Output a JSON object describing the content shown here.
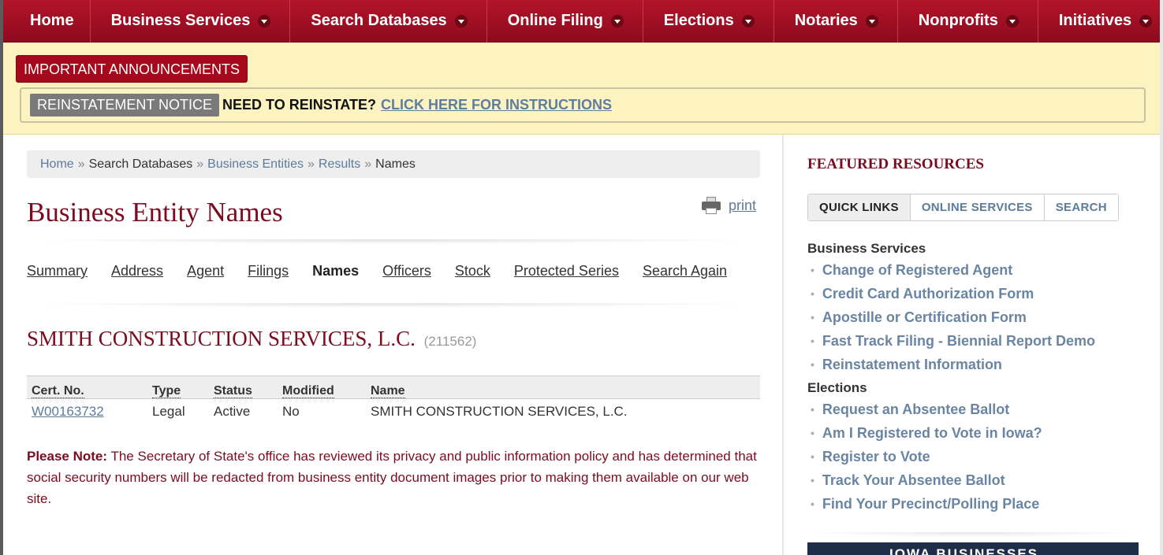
{
  "nav": {
    "items": [
      {
        "label": "Home",
        "dropdown": false
      },
      {
        "label": "Business Services",
        "dropdown": true
      },
      {
        "label": "Search Databases",
        "dropdown": true
      },
      {
        "label": "Online Filing",
        "dropdown": true
      },
      {
        "label": "Elections",
        "dropdown": true
      },
      {
        "label": "Notaries",
        "dropdown": true
      },
      {
        "label": "Nonprofits",
        "dropdown": true
      },
      {
        "label": "Initiatives",
        "dropdown": true
      }
    ]
  },
  "announcements": {
    "button_label": "IMPORTANT ANNOUNCEMENTS",
    "tag": "REINSTATEMENT NOTICE",
    "text": "NEED TO REINSTATE?",
    "link": "CLICK HERE FOR INSTRUCTIONS"
  },
  "breadcrumb": {
    "home": "Home",
    "search_databases": "Search Databases",
    "business_entities": "Business Entities",
    "results": "Results",
    "current": "Names",
    "separator": "»"
  },
  "page": {
    "title": "Business Entity Names",
    "print_label": "print"
  },
  "tabs": [
    "Summary",
    "Address",
    "Agent",
    "Filings",
    "Names",
    "Officers",
    "Stock",
    "Protected Series",
    "Search Again"
  ],
  "entity": {
    "name": "SMITH CONSTRUCTION SERVICES, L.C.",
    "id": "(211562)"
  },
  "table": {
    "headers": [
      "Cert. No.",
      "Type",
      "Status",
      "Modified",
      "Name"
    ],
    "rows": [
      [
        "W00163732",
        "Legal",
        "Active",
        "No",
        "SMITH CONSTRUCTION SERVICES, L.C."
      ]
    ]
  },
  "note": {
    "label": "Please Note:",
    "text": " The Secretary of State's office has reviewed its privacy and public information policy and has determined that social security numbers will be redacted from business entity document images prior to making them available on our web site."
  },
  "sidebar": {
    "title": "FEATURED RESOURCES",
    "tabs": [
      "QUICK LINKS",
      "ONLINE SERVICES",
      "SEARCH"
    ],
    "groups": [
      {
        "heading": "Business Services",
        "links": [
          "Change of Registered Agent",
          "Credit Card Authorization Form",
          "Apostille or Certification Form",
          "Fast Track Filing - Biennial Report Demo",
          "Reinstatement Information"
        ]
      },
      {
        "heading": "Elections",
        "links": [
          "Request an Absentee Ballot",
          "Am I Registered to Vote in Iowa?",
          "Register to Vote",
          "Track Your Absentee Ballot",
          "Find Your Precinct/Polling Place"
        ]
      }
    ],
    "banner_text": "IOWA BUSINESSES"
  },
  "colors": {
    "brand_red": "#a6081c",
    "title_maroon": "#7b0c20",
    "link_blue": "#5d7b9b",
    "announcement_bg": "#fdf3c0"
  }
}
